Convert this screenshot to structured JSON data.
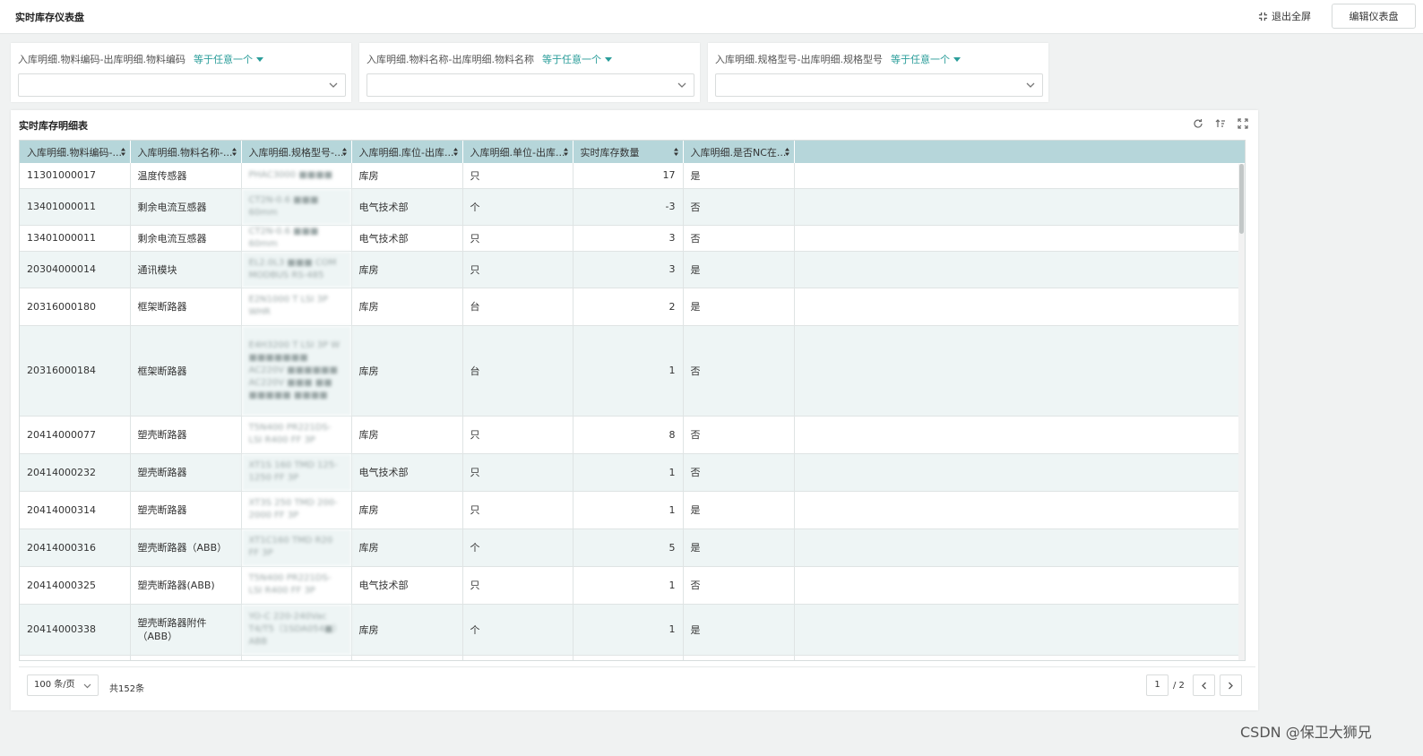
{
  "header": {
    "title": "实时库存仪表盘",
    "exit_fullscreen_label": "退出全屏",
    "edit_dashboard_label": "编辑仪表盘"
  },
  "filters": [
    {
      "label": "入库明细.物料编码-出库明细.物料编码",
      "operator": "等于任意一个",
      "value": ""
    },
    {
      "label": "入库明细.物料名称-出库明细.物料名称",
      "operator": "等于任意一个",
      "value": ""
    },
    {
      "label": "入库明细.规格型号-出库明细.规格型号",
      "operator": "等于任意一个",
      "value": ""
    }
  ],
  "table": {
    "title": "实时库存明细表",
    "columns": [
      "入库明细.物料编码-...",
      "入库明细.物料名称-...",
      "入库明细.规格型号-...",
      "入库明细.库位-出库...",
      "入库明细.单位-出库...",
      "实时库存数量",
      "入库明细.是否NC在..."
    ],
    "rows": [
      {
        "code": "11301000017",
        "name": "温度传感器",
        "spec": "PHAC3000 ■■■■",
        "location": "库房",
        "unit": "只",
        "qty": "17",
        "nc": "是"
      },
      {
        "code": "13401000011",
        "name": "剩余电流互感器",
        "spec": "CT2N-0.6 ■■■ 60mm",
        "location": "电气技术部",
        "unit": "个",
        "qty": "-3",
        "nc": "否"
      },
      {
        "code": "13401000011",
        "name": "剩余电流互感器",
        "spec": "CT2N-0.6 ■■■ 60mm",
        "location": "电气技术部",
        "unit": "只",
        "qty": "3",
        "nc": "否"
      },
      {
        "code": "20304000014",
        "name": "通讯模块",
        "spec": "EL2.0L3 ■■■ COM MODBUS RS-485",
        "location": "库房",
        "unit": "只",
        "qty": "3",
        "nc": "是"
      },
      {
        "code": "20316000180",
        "name": "框架断路器",
        "spec": "E2N1000 T LSI 3P WHR",
        "location": "库房",
        "unit": "台",
        "qty": "2",
        "nc": "是"
      },
      {
        "code": "20316000184",
        "name": "框架断路器",
        "spec": "E4H3200 T LSI 3P W ■■■■■■■ AC220V ■■■■■■ AC220V ■■■ ■■ ■■■■■ ■■■■",
        "location": "库房",
        "unit": "台",
        "qty": "1",
        "nc": "否"
      },
      {
        "code": "20414000077",
        "name": "塑壳断路器",
        "spec": "T5N400 PR221DS-LSI R400 FF 3P",
        "location": "库房",
        "unit": "只",
        "qty": "8",
        "nc": "否"
      },
      {
        "code": "20414000232",
        "name": "塑壳断路器",
        "spec": "XT1S 160 TMD 125-1250 FF 3P",
        "location": "电气技术部",
        "unit": "只",
        "qty": "1",
        "nc": "否"
      },
      {
        "code": "20414000314",
        "name": "塑壳断路器",
        "spec": "XT3S 250 TMD 200-2000 FF 3P",
        "location": "库房",
        "unit": "只",
        "qty": "1",
        "nc": "是"
      },
      {
        "code": "20414000316",
        "name": "塑壳断路器（ABB）",
        "spec": "XT1C160 TMD R20 FF 3P",
        "location": "库房",
        "unit": "个",
        "qty": "5",
        "nc": "是"
      },
      {
        "code": "20414000325",
        "name": "塑壳断路器(ABB)",
        "spec": "T5N400 PR221DS-LSI R400 FF 3P",
        "location": "电气技术部",
        "unit": "只",
        "qty": "1",
        "nc": "否"
      },
      {
        "code": "20414000338",
        "name": "塑壳断路器附件（ABB）",
        "spec": "YO-C 220-240Vac T4/T5（1SDA054■）ABB",
        "location": "库房",
        "unit": "个",
        "qty": "1",
        "nc": "是"
      }
    ]
  },
  "pagination": {
    "page_size": "100 条/页",
    "total": "共152条",
    "current_page": "1",
    "total_pages": "/ 2"
  },
  "watermark": "CSDN @保卫大狮兄",
  "colors": {
    "accent": "#2a9d9a",
    "header_bg": "#b6d6da",
    "row_alt_bg": "#eef5f5"
  }
}
